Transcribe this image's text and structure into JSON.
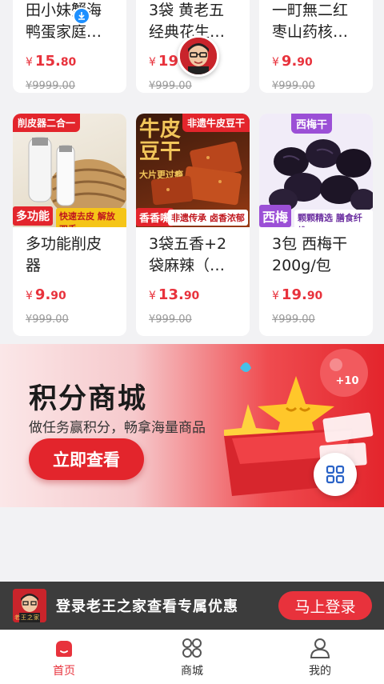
{
  "products_row1": [
    {
      "title": "田小妹蟹海鸭蛋家庭…",
      "price_int": "15.",
      "price_dec": "80",
      "yen": "¥",
      "orig": "¥9999.00"
    },
    {
      "title": "3袋 黄老五经典花生…",
      "price_int": "19",
      "price_dec": "",
      "yen": "¥",
      "orig": "¥999.00"
    },
    {
      "title": "一町無二红枣山药核…",
      "price_int": "9.",
      "price_dec": "90",
      "yen": "¥",
      "orig": "¥999.00"
    }
  ],
  "products_row2": [
    {
      "title": "多功能削皮器",
      "price_int": "9.",
      "price_dec": "90",
      "yen": "¥",
      "orig": "¥999.00",
      "badge_top": "削皮器二合一",
      "badge_left": "多功能",
      "badge_bottom": "快速去皮 解放双手"
    },
    {
      "title": "3袋五香+2袋麻辣（…",
      "price_int": "13.",
      "price_dec": "90",
      "yen": "¥",
      "orig": "¥999.00",
      "badge_top": "非遗牛皮豆干",
      "big_text": "牛皮豆干",
      "slogan": "大片更过瘾",
      "badge_left": "香香嘴",
      "badge_bottom": "非遗传承 卤香浓郁"
    },
    {
      "title": "3包 西梅干200g/包",
      "price_int": "19.",
      "price_dec": "90",
      "yen": "¥",
      "orig": "¥999.00",
      "badge_top": "西梅干",
      "badge_left": "西梅",
      "badge_bottom": "颗颗精选 膳食纤维"
    }
  ],
  "banner": {
    "title": "积分商城",
    "subtitle": "做任务赢积分，畅拿海量商品",
    "button": "立即查看",
    "points_badge": "+10"
  },
  "login_bar": {
    "text": "登录老王之家查看专属优惠",
    "button": "马上登录",
    "logo_text": "老王之家"
  },
  "tabbar": {
    "items": [
      {
        "label": "首页",
        "icon": "home-icon",
        "active": true
      },
      {
        "label": "商城",
        "icon": "grid-icon",
        "active": false
      },
      {
        "label": "我的",
        "icon": "user-icon",
        "active": false
      }
    ]
  },
  "colors": {
    "accent": "#e8323c",
    "login_bar": "#3c3c3c",
    "tab_active": "#e8323c"
  }
}
